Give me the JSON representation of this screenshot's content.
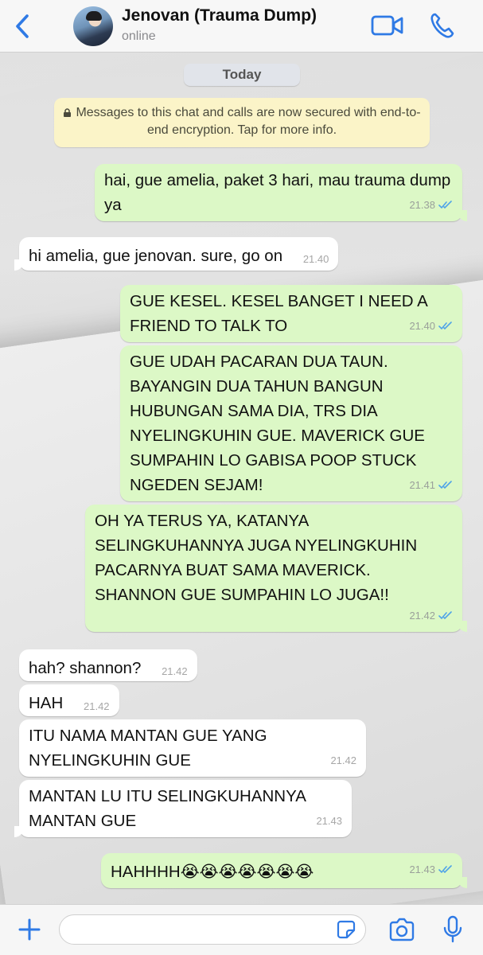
{
  "header": {
    "back_icon": "chevron-left-icon",
    "contact_name": "Jenovan (Trauma Dump)",
    "status": "online",
    "video_icon": "video-camera-icon",
    "call_icon": "phone-icon",
    "accent_color": "#2f7ae5"
  },
  "chat": {
    "date_label": "Today",
    "encryption_notice": "Messages to this chat and calls are now secured with end-to-end encryption. Tap for more info.",
    "messages": [
      {
        "direction": "out",
        "text": "hai, gue amelia, paket 3 hari, mau trauma dump ya",
        "time": "21.38",
        "status": "read"
      },
      {
        "direction": "in",
        "text": "hi amelia, gue jenovan. sure, go on",
        "time": "21.40"
      },
      {
        "direction": "out",
        "text": "GUE KESEL. KESEL BANGET I NEED A FRIEND TO TALK TO",
        "time": "21.40",
        "status": "read"
      },
      {
        "direction": "out",
        "text": "GUE UDAH PACARAN DUA TAUN. BAYANGIN DUA TAHUN BANGUN HUBUNGAN SAMA DIA, TRS DIA NYELINGKUHIN GUE. MAVERICK GUE SUMPAHIN LO GABISA POOP STUCK NGEDEN SEJAM!",
        "time": "21.41",
        "status": "read"
      },
      {
        "direction": "out",
        "text": "OH YA TERUS YA, KATANYA SELINGKUHANNYA JUGA NYELINGKUHIN PACARNYA BUAT SAMA MAVERICK. SHANNON GUE SUMPAHIN LO JUGA!!",
        "time": "21.42",
        "status": "read"
      },
      {
        "direction": "in",
        "text": "hah? shannon?",
        "time": "21.42"
      },
      {
        "direction": "in",
        "text": "HAH",
        "time": "21.42"
      },
      {
        "direction": "in",
        "text": "ITU NAMA MANTAN GUE YANG NYELINGKUHIN GUE",
        "time": "21.42"
      },
      {
        "direction": "in",
        "text": "MANTAN LU ITU SELINGKUHANNYA MANTAN GUE",
        "time": "21.43"
      },
      {
        "direction": "out",
        "text": "HAHHHH😭😭😭😭😭😭😭",
        "time": "21.43",
        "status": "read"
      }
    ],
    "colors": {
      "outgoing": "#dcf8c6",
      "incoming": "#ffffff",
      "read_tick": "#4fa3e8"
    }
  },
  "input_bar": {
    "placeholder": "",
    "value": "",
    "plus_icon": "plus-icon",
    "sticker_icon": "sticker-icon",
    "camera_icon": "camera-icon",
    "mic_icon": "microphone-icon"
  }
}
